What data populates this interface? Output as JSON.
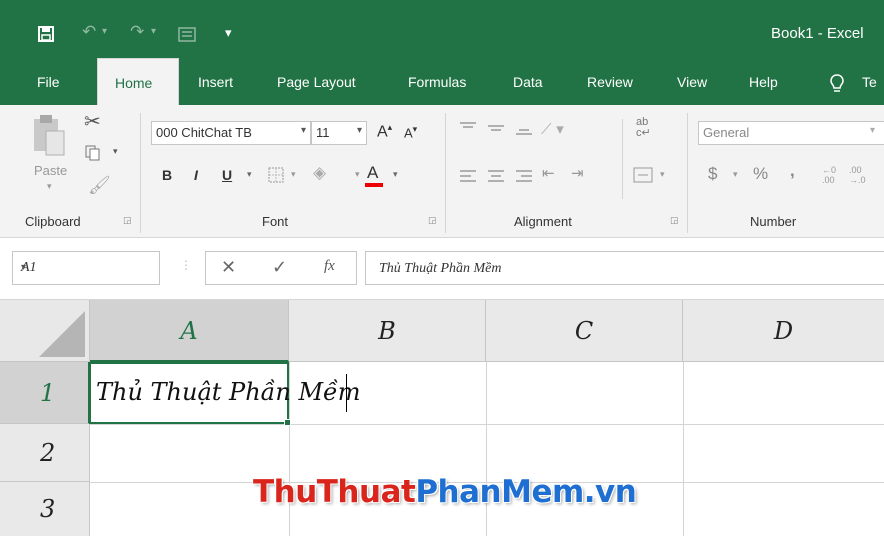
{
  "app": {
    "title": "Book1  -  Excel"
  },
  "colors": {
    "brand": "#217346",
    "watermark_red": "#d9251c",
    "watermark_blue": "#1e6fd1"
  },
  "quick_access": {
    "save_icon": "save-icon",
    "undo_icon": "undo-icon",
    "redo_icon": "redo-icon",
    "form_icon": "form-icon",
    "customize_icon": "customize-qat-icon"
  },
  "tabs": [
    {
      "label": "File"
    },
    {
      "label": "Home",
      "active": true
    },
    {
      "label": "Insert"
    },
    {
      "label": "Page Layout"
    },
    {
      "label": "Formulas"
    },
    {
      "label": "Data"
    },
    {
      "label": "Review"
    },
    {
      "label": "View"
    },
    {
      "label": "Help"
    },
    {
      "label": "Te"
    }
  ],
  "ribbon": {
    "clipboard": {
      "paste_label": "Paste",
      "group_label": "Clipboard"
    },
    "font": {
      "font_name": "000 ChitChat TB",
      "font_size": "11",
      "group_label": "Font",
      "bold": "B",
      "italic": "I",
      "underline": "U",
      "font_color_letter": "A"
    },
    "alignment": {
      "group_label": "Alignment"
    },
    "number": {
      "format": "General",
      "group_label": "Number",
      "currency": "$",
      "percent": "%",
      "comma": ","
    }
  },
  "formula_bar": {
    "name_box": "A1",
    "formula": "Thủ Thuật Phần Mềm",
    "fx_label": "fx"
  },
  "sheet": {
    "columns": [
      "A",
      "B",
      "C",
      "D"
    ],
    "rows": [
      "1",
      "2",
      "3"
    ],
    "active_cell": "A1",
    "cells": {
      "A1": "Thủ Thuật Phần Mềm"
    }
  },
  "watermark": {
    "part1": "ThuThuat",
    "part2": "PhanMem",
    "part3": ".vn"
  }
}
